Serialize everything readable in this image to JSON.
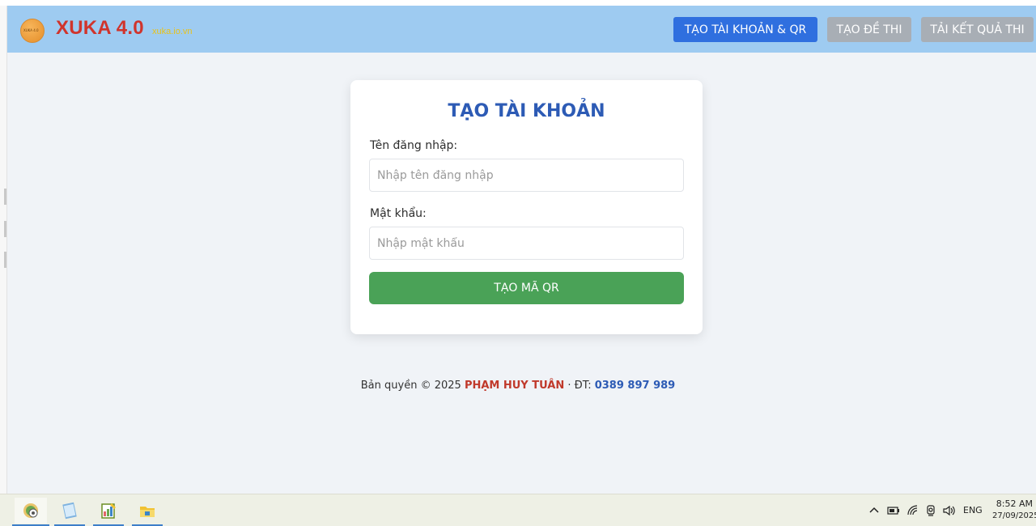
{
  "header": {
    "brand": "XUKA 4.0",
    "domain": "xuka.io.vn",
    "logo_text": "XUKA 4.0",
    "nav": [
      {
        "label": "TẠO TÀI KHOẢN & QR",
        "active": true
      },
      {
        "label": "TẠO ĐỀ THI",
        "active": false
      },
      {
        "label": "TẢI KẾT QUẢ THI",
        "active": false
      }
    ]
  },
  "form": {
    "title": "TẠO TÀI KHOẢN",
    "username_label": "Tên đăng nhập:",
    "username_placeholder": "Nhập tên đăng nhập",
    "username_value": "",
    "password_label": "Mật khẩu:",
    "password_placeholder": "Nhập mật khẩu",
    "password_value": "",
    "submit_label": "TẠO MÃ QR"
  },
  "footer": {
    "prefix": "Bản quyền © 2025 ",
    "author": "PHẠM HUY TUÂN",
    "separator": " · ĐT: ",
    "phone": "0389 897 989"
  },
  "taskbar": {
    "apps": [
      "browser-icon",
      "notepad-icon",
      "editor-icon",
      "file-explorer-icon"
    ],
    "tray": {
      "language": "ENG",
      "time": "8:52 AM",
      "date": "27/09/2025"
    }
  },
  "colors": {
    "header_bg": "#9ecbf1",
    "brand": "#d0342c",
    "active_nav": "#2f6fdf",
    "inactive_nav": "#a8aeb5",
    "title": "#2d5bb5",
    "submit": "#4aa257",
    "author": "#c0392b"
  }
}
